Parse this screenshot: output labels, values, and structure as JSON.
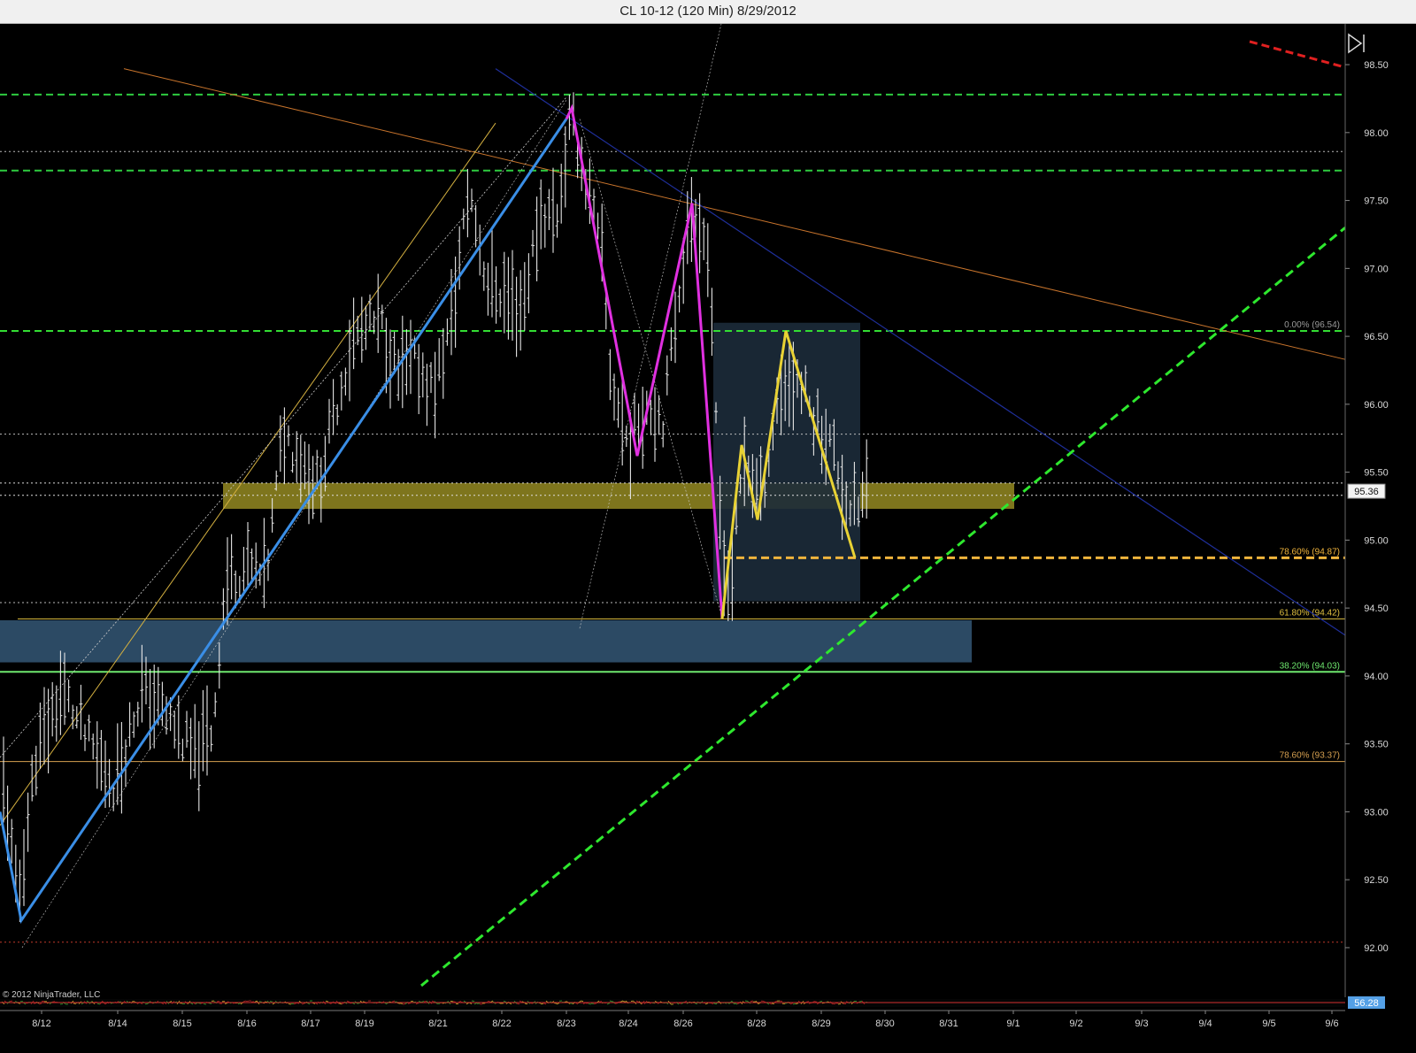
{
  "window": {
    "title": "CL 10-12 (120 Min)  8/29/2012"
  },
  "chart_data": {
    "type": "candlestick",
    "instrument": "CL 10-12",
    "interval": "120 Min",
    "date": "8/29/2012",
    "ylim": [
      91.7,
      98.8
    ],
    "y_ticks": [
      "98.50",
      "98.00",
      "97.50",
      "97.00",
      "96.50",
      "96.00",
      "95.50",
      "95.00",
      "94.50",
      "94.00",
      "93.50",
      "93.00",
      "92.50",
      "92.00"
    ],
    "x_ticks": [
      "8/12",
      "8/14",
      "8/15",
      "8/16",
      "8/17",
      "8/19",
      "8/21",
      "8/22",
      "8/23",
      "8/24",
      "8/26",
      "8/28",
      "8/29",
      "8/30",
      "8/31",
      "9/1",
      "9/2",
      "9/3",
      "9/4",
      "9/5",
      "9/6"
    ],
    "last_price": "95.36",
    "indicator_value": "56.28",
    "copyright": "© 2012 NinjaTrader, LLC",
    "fib_levels": [
      {
        "label": "0.00% (96.54)",
        "price": 96.54,
        "color": "#9a9a9a"
      },
      {
        "label": "78.60% (94.87)",
        "price": 94.87,
        "color": "#f0b43c"
      },
      {
        "label": "61.80% (94.42)",
        "price": 94.42,
        "color": "#e0c040"
      },
      {
        "label": "38.20% (94.03)",
        "price": 94.03,
        "color": "#6ee86e"
      },
      {
        "label": "78.60% (93.37)",
        "price": 93.37,
        "color": "#d6a050"
      }
    ],
    "horizontal_levels": [
      {
        "price": 98.28,
        "color": "#2ecc40",
        "style": "dashed"
      },
      {
        "price": 97.72,
        "color": "#2ecc40",
        "style": "dashed"
      },
      {
        "price": 96.54,
        "color": "#33dd33",
        "style": "dashed"
      },
      {
        "price": 97.86,
        "color": "#bbbbbb",
        "style": "dotted"
      },
      {
        "price": 95.78,
        "color": "#bbbbbb",
        "style": "dotted"
      },
      {
        "price": 95.42,
        "color": "#dddddd",
        "style": "dotted"
      },
      {
        "price": 95.33,
        "color": "#dddddd",
        "style": "dotted"
      },
      {
        "price": 94.54,
        "color": "#bbbbbb",
        "style": "dotted"
      },
      {
        "price": 92.04,
        "color": "#c0392b",
        "style": "dotted"
      }
    ],
    "zones": [
      {
        "name": "resistance-zone",
        "from_date": "8/15",
        "to_date": "8/31",
        "price_top": 95.42,
        "price_bottom": 95.23,
        "color": "#b3a62a"
      },
      {
        "name": "support-zone",
        "from_date": "8/11",
        "to_date": "8/30",
        "price_top": 94.41,
        "price_bottom": 94.1,
        "color": "#3f6a8e"
      },
      {
        "name": "consolidation-box",
        "from_date": "8/26",
        "to_date": "8/29",
        "price_top": 96.6,
        "price_bottom": 94.55,
        "color": "#1c2b3a"
      }
    ],
    "swing_blue": [
      [
        92.2,
        0
      ],
      [
        98.1,
        1
      ]
    ],
    "swing_magenta": [
      98.18,
      95.62,
      97.48,
      94.42
    ],
    "swing_yellow": [
      94.42,
      95.7,
      95.15,
      96.54,
      94.87
    ]
  }
}
